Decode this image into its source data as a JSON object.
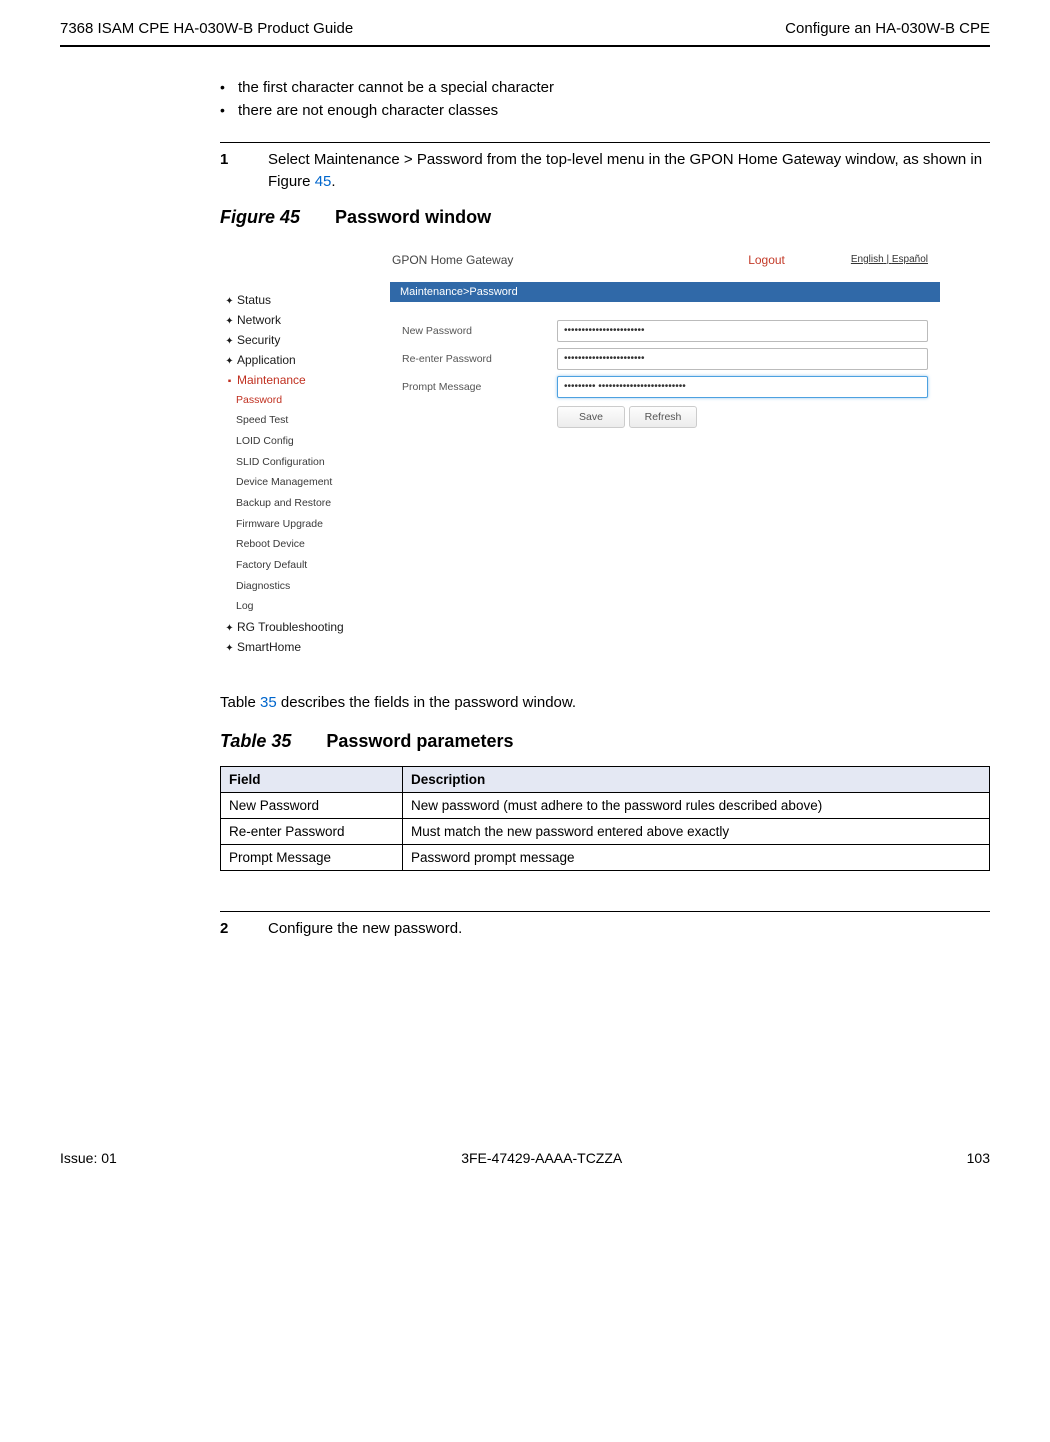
{
  "header": {
    "left": "7368 ISAM CPE HA-030W-B Product Guide",
    "right": "Configure an HA-030W-B CPE"
  },
  "bullets": [
    "the first character cannot be a special character",
    "there are not enough character classes"
  ],
  "step1": {
    "num": "1",
    "text_a": "Select Maintenance > Password from the top-level menu in the GPON Home Gateway window, as shown in Figure ",
    "link": "45",
    "text_b": "."
  },
  "figure": {
    "label": "Figure 45",
    "title": "Password window"
  },
  "screenshot": {
    "header_title": "GPON Home Gateway",
    "logout": "Logout",
    "lang_en": "English",
    "lang_sep": " | ",
    "lang_es": "Español",
    "breadcrumb": "Maintenance>Password",
    "sidebar_top": [
      "Status",
      "Network",
      "Security",
      "Application"
    ],
    "sidebar_active": "Maintenance",
    "sidebar_sub": [
      "Password",
      "Speed Test",
      "LOID Config",
      "SLID Configuration",
      "Device Management",
      "Backup and Restore",
      "Firmware Upgrade",
      "Reboot Device",
      "Factory Default",
      "Diagnostics",
      "Log"
    ],
    "sidebar_bottom": [
      "RG Troubleshooting",
      "SmartHome"
    ],
    "rows": {
      "new_password_label": "New Password",
      "reenter_password_label": "Re-enter Password",
      "prompt_message_label": "Prompt Message",
      "new_password_value": "•••••••••••••••••••••••",
      "reenter_password_value": "•••••••••••••••••••••••",
      "prompt_message_value": "••••••••• •••••••••••••••••••••••••"
    },
    "buttons": {
      "save": "Save",
      "refresh": "Refresh"
    }
  },
  "para_before_table": {
    "a": "Table ",
    "link": "35",
    "b": " describes the fields in the password window."
  },
  "table": {
    "label": "Table 35",
    "title": "Password parameters",
    "head_field": "Field",
    "head_desc": "Description",
    "rows": [
      {
        "field": "New Password",
        "desc": "New password (must adhere to the password rules described above)"
      },
      {
        "field": "Re-enter Password",
        "desc": "Must match the new password entered above exactly"
      },
      {
        "field": "Prompt Message",
        "desc": "Password prompt message"
      }
    ]
  },
  "step2": {
    "num": "2",
    "text": "Configure the new password."
  },
  "footer": {
    "left": "Issue: 01",
    "center": "3FE-47429-AAAA-TCZZA",
    "right": "103"
  }
}
